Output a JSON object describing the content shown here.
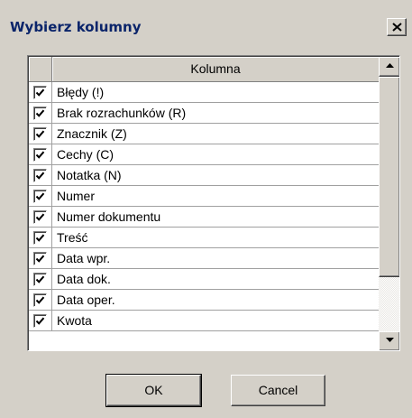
{
  "dialog": {
    "title": "Wybierz kolumny"
  },
  "grid": {
    "column_header": "Kolumna",
    "rows": [
      {
        "label": "Błędy  (!)",
        "checked": true
      },
      {
        "label": "Brak rozrachunków  (R)",
        "checked": true
      },
      {
        "label": "Znacznik  (Z)",
        "checked": true
      },
      {
        "label": "Cechy  (C)",
        "checked": true
      },
      {
        "label": "Notatka  (N)",
        "checked": true
      },
      {
        "label": "Numer",
        "checked": true
      },
      {
        "label": "Numer dokumentu",
        "checked": true
      },
      {
        "label": "Treść",
        "checked": true
      },
      {
        "label": "Data wpr.",
        "checked": true
      },
      {
        "label": "Data dok.",
        "checked": true
      },
      {
        "label": "Data oper.",
        "checked": true
      },
      {
        "label": "Kwota",
        "checked": true
      }
    ]
  },
  "buttons": {
    "ok_label": "OK",
    "cancel_label": "Cancel"
  },
  "icons": {
    "close": "close-icon",
    "scroll_up": "arrow-up-icon",
    "scroll_down": "arrow-down-icon",
    "check": "check-icon"
  },
  "colors": {
    "title_text": "#0a246a",
    "window_bg": "#d4d0c8"
  }
}
